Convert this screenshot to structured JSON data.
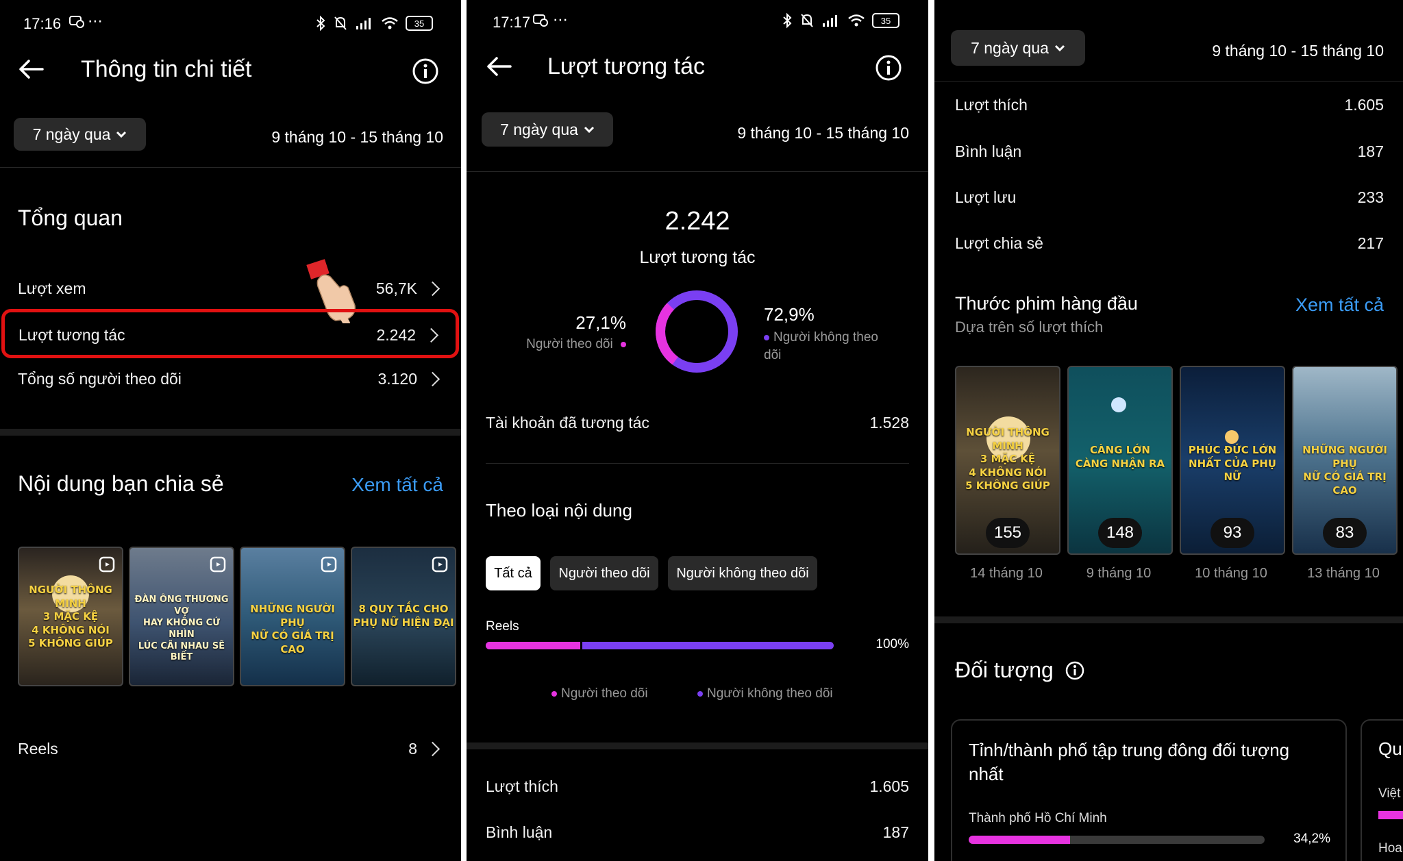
{
  "colors": {
    "accent_pink": "#e633e0",
    "accent_purple": "#7a3ff2",
    "link_blue": "#3b9cf6",
    "highlight_red": "#e11111"
  },
  "panel1": {
    "status": {
      "time": "17:16",
      "extra": "⋯",
      "battery": "35"
    },
    "title": "Thông tin chi tiết",
    "dropdown": "7 ngày qua",
    "date_range": "9 tháng 10 - 15 tháng 10",
    "overview_heading": "Tổng quan",
    "rows": [
      {
        "label": "Lượt xem",
        "value": "56,7K"
      },
      {
        "label": "Lượt tương tác",
        "value": "2.242"
      },
      {
        "label": "Tổng số người theo dõi",
        "value": "3.120"
      }
    ],
    "shared_heading": "Nội dung bạn chia sẻ",
    "see_all": "Xem tất cả",
    "thumbs": [
      {
        "caption": "NGƯỜI THÔNG MINH\n3 MẶC KỆ\n4 KHÔNG NÓI\n5 KHÔNG GIÚP"
      },
      {
        "caption": "ĐÀN ÔNG THƯƠNG VỢ\nHAY KHÔNG CỨ NHÌN\nLÚC CÃI NHAU SẼ BIẾT"
      },
      {
        "caption": "NHỮNG NGƯỜI PHỤ\nNỮ CÓ GIÁ TRỊ CAO"
      },
      {
        "caption": "8 QUY TẮC CHO\nPHỤ NỮ HIỆN ĐẠI"
      }
    ],
    "reels_label": "Reels",
    "reels_value": "8"
  },
  "panel2": {
    "status": {
      "time": "17:17",
      "extra": "⋯",
      "battery": "35"
    },
    "title": "Lượt tương tác",
    "dropdown": "7 ngày qua",
    "date_range": "9 tháng 10 - 15 tháng 10",
    "total": "2.242",
    "total_label": "Lượt tương tác",
    "followers_pct": "27,1%",
    "followers_label": "Người theo dõi",
    "nonfollowers_pct": "72,9%",
    "nonfollowers_label": "Người không theo dõi",
    "donut_followers_fraction": 0.271,
    "accounts_label": "Tài khoản đã tương tác",
    "accounts_value": "1.528",
    "by_type_heading": "Theo loại nội dung",
    "filters": [
      "Tất cả",
      "Người theo dõi",
      "Người không theo dõi"
    ],
    "bar_label": "Reels",
    "bar_value": "100%",
    "bar_followers_fraction": 0.271,
    "legend": [
      "Người theo dõi",
      "Người không theo dõi"
    ],
    "rows": [
      {
        "label": "Lượt thích",
        "value": "1.605"
      },
      {
        "label": "Bình luận",
        "value": "187"
      }
    ]
  },
  "panel3": {
    "dropdown": "7 ngày qua",
    "date_range": "9 tháng 10 - 15 tháng 10",
    "rows": [
      {
        "label": "Lượt thích",
        "value": "1.605"
      },
      {
        "label": "Bình luận",
        "value": "187"
      },
      {
        "label": "Lượt lưu",
        "value": "233"
      },
      {
        "label": "Lượt chia sẻ",
        "value": "217"
      }
    ],
    "top_heading": "Thước phim hàng đầu",
    "top_sub": "Dựa trên số lượt thích",
    "see_all": "Xem tất cả",
    "reels": [
      {
        "caption": "NGƯỜI THÔNG MINH\n3 MẶC KỆ\n4 KHÔNG NÓI\n5 KHÔNG GIÚP",
        "count": "155",
        "date": "14 tháng 10"
      },
      {
        "caption": "CÀNG LỚN\nCÀNG NHẬN RA",
        "count": "148",
        "date": "9 tháng 10"
      },
      {
        "caption": "PHÚC ĐỨC LỚN\nNHẤT CỦA PHỤ NỮ",
        "count": "93",
        "date": "10 tháng 10"
      },
      {
        "caption": "NHỮNG NGƯỜI PHỤ\nNỮ CÓ GIÁ TRỊ CAO",
        "count": "83",
        "date": "13 tháng 10"
      }
    ],
    "audience_heading": "Đối tượng",
    "card_title": "Tỉnh/thành phố tập trung đông đối tượng nhất",
    "city_label": "Thành phố Hồ Chí Minh",
    "city_value": "34,2%",
    "city_fraction": 0.342,
    "card2_title_fragment": "Qu",
    "card2_line1": "Việt",
    "card2_line2": "Hoa"
  }
}
